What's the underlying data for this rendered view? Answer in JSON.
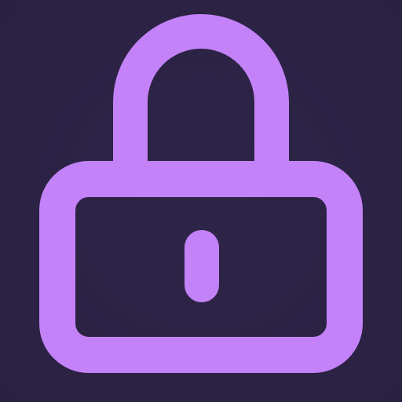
{
  "icon": {
    "name": "lock-icon",
    "state": "locked"
  },
  "colors": {
    "background": "#2e2448",
    "background_edge": "#2a2142",
    "icon": "#c382f7"
  }
}
